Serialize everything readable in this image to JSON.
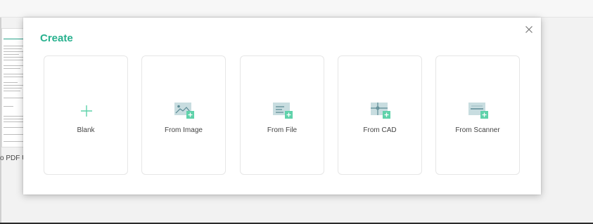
{
  "background": {
    "partial_label": "o PDF U"
  },
  "modal": {
    "title": "Create",
    "close_icon": "close-icon",
    "cards": [
      {
        "label": "Blank",
        "icon": "plus-icon"
      },
      {
        "label": "From Image",
        "icon": "image-plus-icon"
      },
      {
        "label": "From File",
        "icon": "file-plus-icon"
      },
      {
        "label": "From CAD",
        "icon": "cad-plus-icon"
      },
      {
        "label": "From Scanner",
        "icon": "scanner-plus-icon"
      }
    ]
  },
  "colors": {
    "accent": "#27b18e",
    "icon_fill": "#c8dde0",
    "plus_badge": "#5fd2aa"
  }
}
